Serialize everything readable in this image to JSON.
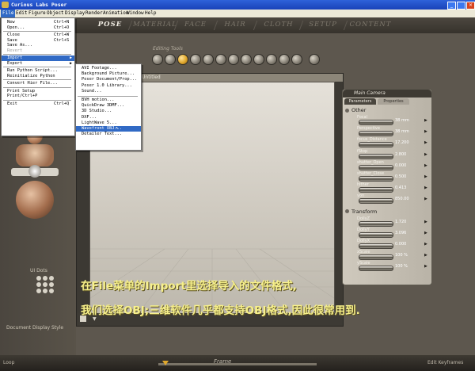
{
  "window": {
    "title": "Curious Labs Poser"
  },
  "menubar": [
    "File",
    "Edit",
    "Figure",
    "Object",
    "Display",
    "Render",
    "Animation",
    "Window",
    "Help"
  ],
  "rooms": [
    "POSE",
    "MATERIAL",
    "FACE",
    "HAIR",
    "CLOTH",
    "SETUP",
    "CONTENT"
  ],
  "editing_tools_label": "Editing Tools",
  "document": {
    "title": "Untitled",
    "display_style_label": "Document Display Style"
  },
  "ui_dots_label": "UI Dots",
  "file_menu": [
    {
      "label": "New",
      "shortcut": "Ctrl+N"
    },
    {
      "label": "Open...",
      "shortcut": "Ctrl+O"
    },
    {
      "sep": true
    },
    {
      "label": "Close",
      "shortcut": "Ctrl+W"
    },
    {
      "label": "Save",
      "shortcut": "Ctrl+S"
    },
    {
      "label": "Save As...",
      "shortcut": ""
    },
    {
      "label": "Revert",
      "shortcut": "",
      "disabled": true
    },
    {
      "sep": true
    },
    {
      "label": "Import",
      "shortcut": "",
      "submenu": true,
      "highlight": true
    },
    {
      "label": "Export",
      "shortcut": "",
      "submenu": true
    },
    {
      "sep": true
    },
    {
      "label": "Run Python Script...",
      "shortcut": ""
    },
    {
      "label": "Reinitialize Python",
      "shortcut": ""
    },
    {
      "sep": true
    },
    {
      "label": "Convert Hier File...",
      "shortcut": ""
    },
    {
      "sep": true
    },
    {
      "label": "Print Setup",
      "shortcut": ""
    },
    {
      "label": "Print/Ctrl+P",
      "shortcut": ""
    },
    {
      "sep": true
    },
    {
      "label": "Exit",
      "shortcut": "Ctrl+Q"
    }
  ],
  "import_menu": [
    {
      "label": "AVI Footage..."
    },
    {
      "label": "Background Picture..."
    },
    {
      "label": "Poser Document/Prop..."
    },
    {
      "label": "Poser 1.0 Library..."
    },
    {
      "label": "Sound..."
    },
    {
      "sep": true
    },
    {
      "label": "BVH motion..."
    },
    {
      "label": "QuickDraw 3DMF..."
    },
    {
      "label": "3D Studio..."
    },
    {
      "label": "DXF..."
    },
    {
      "label": "LightWave 5..."
    },
    {
      "label": "Wavefront OBJ...",
      "highlight": true
    },
    {
      "label": "Detailer Text..."
    }
  ],
  "param_panel": {
    "title": "Main Camera",
    "tabs": [
      "Parameters",
      "Properties"
    ],
    "groups": [
      {
        "name": "Other",
        "params": [
          {
            "label": "Focal",
            "value": "38 mm"
          },
          {
            "label": "Perspective",
            "value": "38 mm"
          },
          {
            "label": "focus_Distance",
            "value": "17.200"
          },
          {
            "label": "fStop",
            "value": "2.800"
          },
          {
            "label": "shutter_Open",
            "value": "0.000"
          },
          {
            "label": "shutter_Close",
            "value": "0.500"
          },
          {
            "label": "hither",
            "value": "0.413"
          },
          {
            "label": "yon",
            "value": "850.00"
          }
        ]
      },
      {
        "name": "Transform",
        "params": [
          {
            "label": "DollyZ",
            "value": "1.720"
          },
          {
            "label": "DollyY",
            "value": "3.096"
          },
          {
            "label": "DollyX",
            "value": "0.000"
          },
          {
            "label": "xScale",
            "value": "100 %"
          },
          {
            "label": "yScale",
            "value": "100 %"
          }
        ]
      }
    ]
  },
  "annotations": {
    "line1": "在File菜单的Import里选择导入的文件格式,",
    "line2": "我们选择OBJ;三维软件几乎都支持OBJ格式,因此很常用到."
  },
  "bottom": {
    "frame_label": "Frame",
    "left_label": "Loop",
    "right_label": "Edit Keyframes"
  },
  "colors": {
    "accent": "#316ac5",
    "annotation": "#f7f08a",
    "room_selected": "#f2eee4"
  }
}
